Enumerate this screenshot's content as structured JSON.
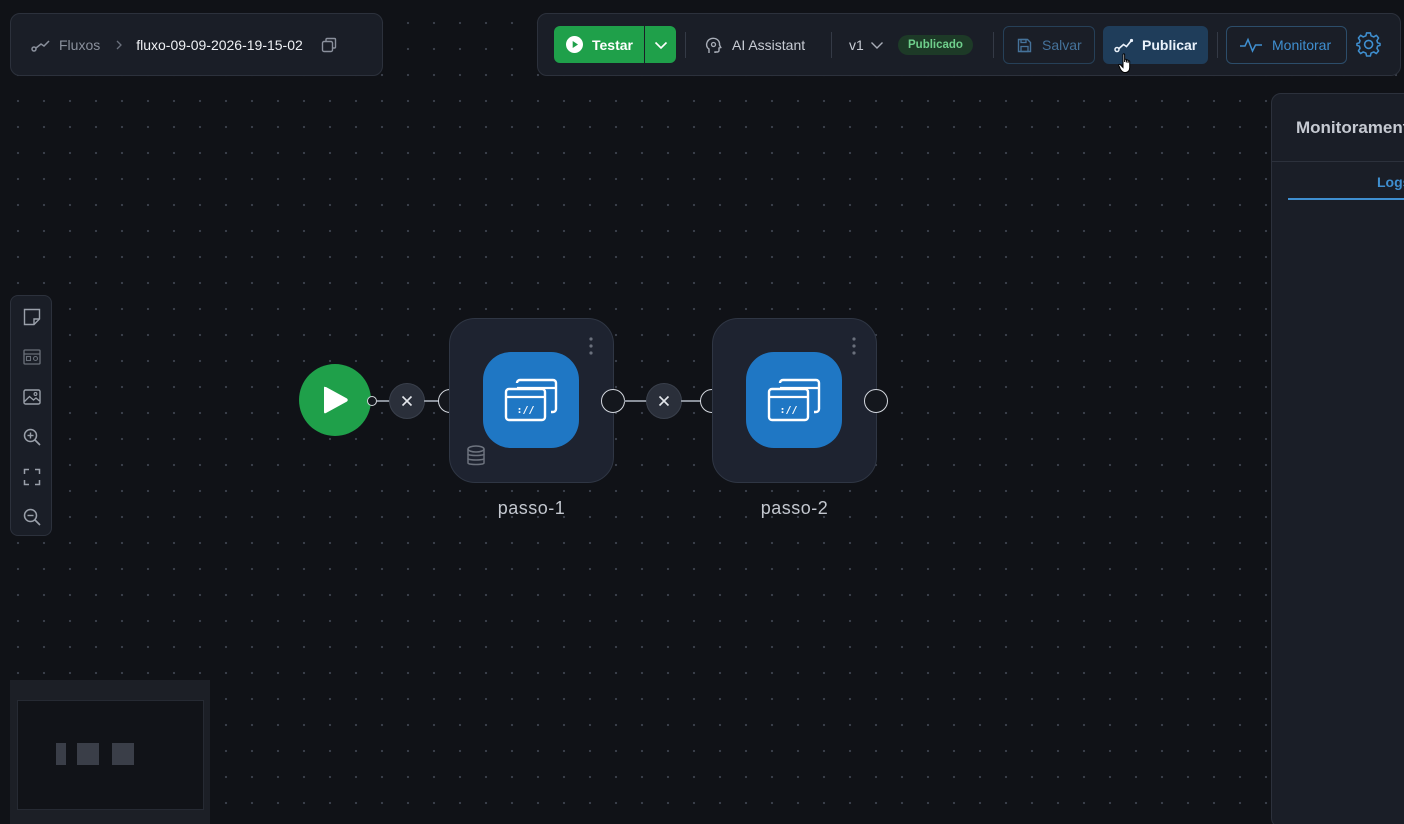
{
  "breadcrumb": {
    "root": "Fluxos",
    "current": "fluxo-09-09-2026-19-15-02"
  },
  "toolbar": {
    "test_label": "Testar",
    "ai_label": "AI Assistant",
    "version": "v1",
    "status_badge": "Publicado",
    "save_label": "Salvar",
    "publish_label": "Publicar",
    "monitor_label": "Monitorar"
  },
  "canvas": {
    "steps": [
      {
        "label": "passo-1"
      },
      {
        "label": "passo-2"
      }
    ]
  },
  "monitor_panel": {
    "title": "Monitoramento",
    "active_tab": "Logs"
  },
  "colors": {
    "accent": "#3f8fd0",
    "success": "#1fa04a",
    "step_icon": "#1f77c4"
  }
}
